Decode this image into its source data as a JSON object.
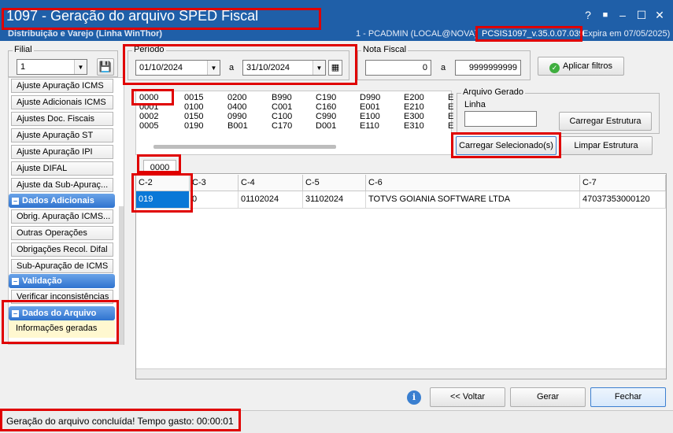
{
  "window": {
    "title": "1097 - Geração do arquivo SPED Fiscal",
    "subtitle": "Distribuição e Varejo (Linha WinThor)",
    "user_info": "1 - PCADMIN (LOCAL@NOVA)",
    "version": "PCSIS1097_v.35.0.07.039",
    "expira": "Expira em 07/05/2025)",
    "controls": [
      "?",
      "■",
      "–",
      "☐",
      "✕"
    ]
  },
  "filial": {
    "label": "Filial",
    "value": "1"
  },
  "periodo": {
    "label": "Período",
    "start": "01/10/2024",
    "sep": "a",
    "end": "31/10/2024"
  },
  "nota_fiscal": {
    "label": "Nota Fiscal",
    "start": "0",
    "sep": "a",
    "end": "9999999999"
  },
  "aplicar_filtros": "Aplicar filtros",
  "sidebar": {
    "items_top": [
      "Ajuste Apuração ICMS",
      "Ajuste Adicionais ICMS",
      "Ajustes Doc. Fiscais",
      "Ajuste Apuração ST",
      "Ajuste Apuração IPI",
      "Ajuste DIFAL",
      "Ajuste da Sub-Apuraç..."
    ],
    "section_adicionais": "Dados Adicionais",
    "items_adicionais": [
      "Obrig. Apuração ICMS...",
      "Outras Operações",
      "Obrigações Recol. Difal",
      "Sub-Apuração de ICMS"
    ],
    "section_validacao": "Validação",
    "items_validacao": [
      "Verificar inconsistências"
    ],
    "section_arquivo": "Dados do Arquivo",
    "items_arquivo": [
      "Informações geradas"
    ]
  },
  "structure_codes": [
    [
      "0000",
      "0015",
      "0200",
      "B990",
      "C190",
      "D990",
      "E200",
      "E"
    ],
    [
      "0001",
      "0100",
      "0400",
      "C001",
      "C160",
      "E001",
      "E210",
      "E"
    ],
    [
      "0002",
      "0150",
      "0990",
      "C100",
      "C990",
      "E100",
      "E300",
      "E"
    ],
    [
      "0005",
      "0190",
      "B001",
      "C170",
      "D001",
      "E110",
      "E310",
      "E"
    ]
  ],
  "arquivo_gerado": {
    "label": "Arquivo Gerado",
    "linha_label": "Linha",
    "linha_value": ""
  },
  "carregar_estrutura": "Carregar Estrutura",
  "carregar_selecionados": "Carregar Selecionado(s)",
  "limpar_estrutura": "Limpar Estrutura",
  "tab_label": "0000",
  "table": {
    "headers": [
      "C-2",
      "C-3",
      "C-4",
      "C-5",
      "C-6",
      "C-7"
    ],
    "rows": [
      [
        "019",
        "0",
        "01102024",
        "31102024",
        "TOTVS GOIANIA SOFTWARE LTDA",
        "47037353000120"
      ]
    ]
  },
  "buttons": {
    "voltar": "<< Voltar",
    "gerar": "Gerar",
    "fechar": "Fechar"
  },
  "status": "Geração do arquivo concluída! Tempo gasto: 00:00:01",
  "accent_color": "#1f5fa8",
  "highlight_color": "#e00000"
}
